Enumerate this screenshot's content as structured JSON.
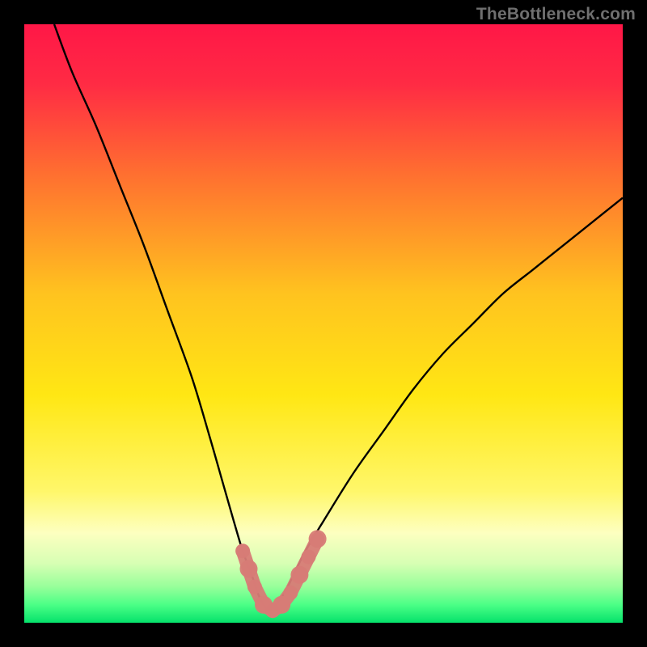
{
  "watermark": {
    "text": "TheBottleneck.com"
  },
  "chart_data": {
    "type": "line",
    "title": "",
    "xlabel": "",
    "ylabel": "",
    "xlim": [
      0,
      100
    ],
    "ylim": [
      0,
      100
    ],
    "grid": false,
    "series": [
      {
        "name": "curve",
        "x": [
          5,
          8,
          12,
          16,
          20,
          24,
          28,
          31,
          33,
          35,
          36.5,
          38,
          39,
          40,
          41,
          42,
          43.5,
          45,
          47,
          50,
          55,
          60,
          65,
          70,
          75,
          80,
          85,
          90,
          95,
          100
        ],
        "y": [
          100,
          92,
          83,
          73,
          63,
          52,
          41,
          31,
          24,
          17,
          12,
          8,
          5,
          3,
          2,
          3,
          5,
          8,
          12,
          17,
          25,
          32,
          39,
          45,
          50,
          55,
          59,
          63,
          67,
          71
        ]
      },
      {
        "name": "markers",
        "x": [
          36.5,
          37.5,
          38.5,
          40,
          41.5,
          43,
          44.5,
          46,
          47.5,
          49
        ],
        "y": [
          12,
          9,
          6,
          3,
          2,
          3,
          5,
          8,
          11,
          14
        ]
      }
    ],
    "background_gradient": {
      "stops": [
        {
          "offset": 0.0,
          "color": "#ff1747"
        },
        {
          "offset": 0.1,
          "color": "#ff2b44"
        },
        {
          "offset": 0.25,
          "color": "#ff6f30"
        },
        {
          "offset": 0.45,
          "color": "#ffc31f"
        },
        {
          "offset": 0.62,
          "color": "#ffe714"
        },
        {
          "offset": 0.78,
          "color": "#fff76a"
        },
        {
          "offset": 0.85,
          "color": "#fdffc0"
        },
        {
          "offset": 0.9,
          "color": "#d8ffb4"
        },
        {
          "offset": 0.94,
          "color": "#97ff9a"
        },
        {
          "offset": 0.97,
          "color": "#4bff86"
        },
        {
          "offset": 1.0,
          "color": "#05e26b"
        }
      ]
    },
    "curve_color": "#000000",
    "marker_color": "#d77b76"
  }
}
